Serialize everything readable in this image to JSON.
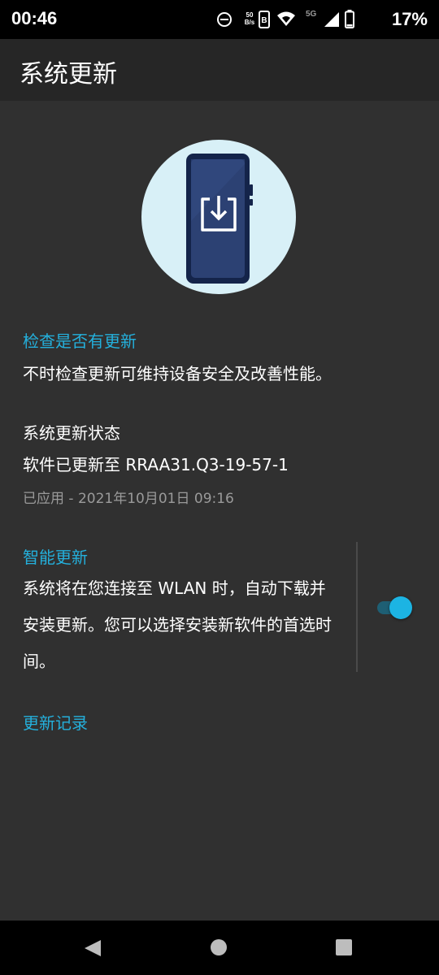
{
  "status_bar": {
    "time": "00:46",
    "net_speed_value": "50",
    "net_speed_unit": "B/s",
    "network_type": "5G",
    "battery": "17%",
    "icons": [
      "do-not-disturb-icon",
      "volte-icon",
      "wifi-icon",
      "signal-icon",
      "battery-icon"
    ]
  },
  "app_bar": {
    "title": "系统更新"
  },
  "check_update": {
    "title": "检查是否有更新",
    "description": "不时检查更新可维持设备安全及改善性能。"
  },
  "update_status": {
    "title": "系统更新状态",
    "version": "软件已更新至 RRAA31.Q3-19-57-1",
    "applied": "已应用 - 2021年10月01日 09:16"
  },
  "smart_update": {
    "title": "智能更新",
    "description": "系统将在您连接至 WLAN 时，自动下载并安装更新。您可以选择安装新软件的首选时间。",
    "enabled": true
  },
  "history": {
    "title": "更新记录"
  },
  "colors": {
    "accent": "#24b0dc",
    "background": "#303030",
    "app_bar": "#262626",
    "toggle_on": "#1cb4e3"
  },
  "nav_bar": {
    "icons": [
      "back-icon",
      "home-icon",
      "recents-icon"
    ]
  }
}
